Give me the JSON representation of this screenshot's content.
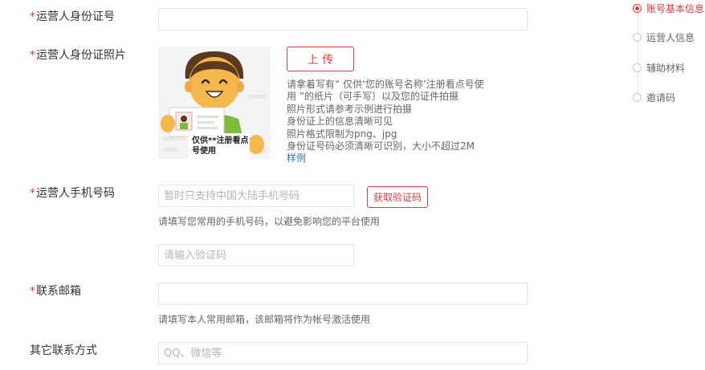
{
  "form": {
    "required_mark": "*",
    "id_number": {
      "label": "运营人身份证号",
      "value": "",
      "placeholder": ""
    },
    "id_photo": {
      "label": "运营人身份证照片",
      "upload_label": "上 传",
      "card_caption_line1": "仅供**注册看点",
      "card_caption_line2": "号使用",
      "instructions": [
        "请拿着写有“ 仅供‘您的账号名称’注册看点号使",
        "用 ”的纸片（可手写）以及您的证件拍摄",
        "照片形式请参考示例进行拍摄",
        "身份证上的信息清晰可见",
        "照片格式限制为png、jpg",
        "身份证号码必须清晰可识别，大小不超过2M"
      ],
      "sample_link": "样例"
    },
    "phone": {
      "label": "运营人手机号码",
      "placeholder": "暂时只支持中国大陆手机号码",
      "get_code_label": "获取验证码",
      "hint": "请填写您常用的手机号码，以避免影响您的平台使用",
      "code_placeholder": "请输入验证码"
    },
    "email": {
      "label": "联系邮箱",
      "placeholder": "",
      "hint": "请填写本人常用邮箱，该邮箱将作为帐号激活使用"
    },
    "other_contact": {
      "label": "其它联系方式",
      "placeholder": "QQ、微信等"
    }
  },
  "side_nav": {
    "items": [
      {
        "label": "账号基本信息",
        "active": true
      },
      {
        "label": "运营人信息",
        "active": false
      },
      {
        "label": "辅助材料",
        "active": false
      },
      {
        "label": "邀请码",
        "active": false
      }
    ]
  },
  "colors": {
    "accent": "#e0393e",
    "link": "#2f6fbf",
    "illustration_shirt": "#7cbc3b",
    "illustration_skin": "#f5b74c"
  }
}
